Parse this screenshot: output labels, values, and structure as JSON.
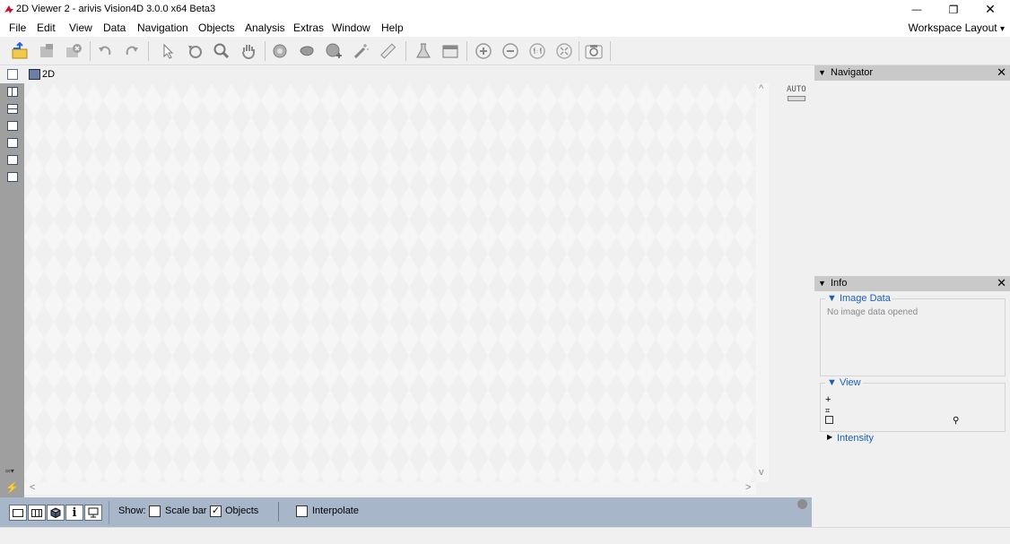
{
  "window": {
    "title": "2D Viewer 2 - arivis Vision4D 3.0.0 x64 Beta3",
    "controls": {
      "minimize": "—",
      "restore": "❐",
      "close": "✕"
    }
  },
  "menu": {
    "items": [
      "File",
      "Edit",
      "View",
      "Data",
      "Navigation",
      "Objects",
      "Analysis",
      "Extras",
      "Window",
      "Help"
    ],
    "workspace_layout": "Workspace Layout",
    "workspace_arrow": "▾"
  },
  "viewer": {
    "tab_label": "2D",
    "auto_label": "AUTO",
    "scroll_up": "^",
    "scroll_down": "v",
    "scroll_left": "<",
    "scroll_right": ">"
  },
  "bottom_bar": {
    "show_label": "Show:",
    "scale_bar_label": "Scale bar",
    "scale_bar_checked": false,
    "objects_label": "Objects",
    "objects_checked": true,
    "interpolate_label": "Interpolate",
    "interpolate_checked": false,
    "checkmark": "✓",
    "info_glyph": "i"
  },
  "navigator": {
    "title": "Navigator",
    "close": "✕",
    "collapse": "▼"
  },
  "info": {
    "title": "Info",
    "close": "✕",
    "collapse": "▼",
    "image_data": {
      "title": "▼ Image Data",
      "message": "No image data opened"
    },
    "view": {
      "title": "▼ View"
    },
    "intensity": {
      "title": "Intensity",
      "arrow": "▶"
    }
  },
  "colors": {
    "accent_blue": "#1a5fb4",
    "bottom_bar": "#a7b7c9",
    "left_strip": "#9f9f9f",
    "panel_header": "#c9c9c9"
  }
}
